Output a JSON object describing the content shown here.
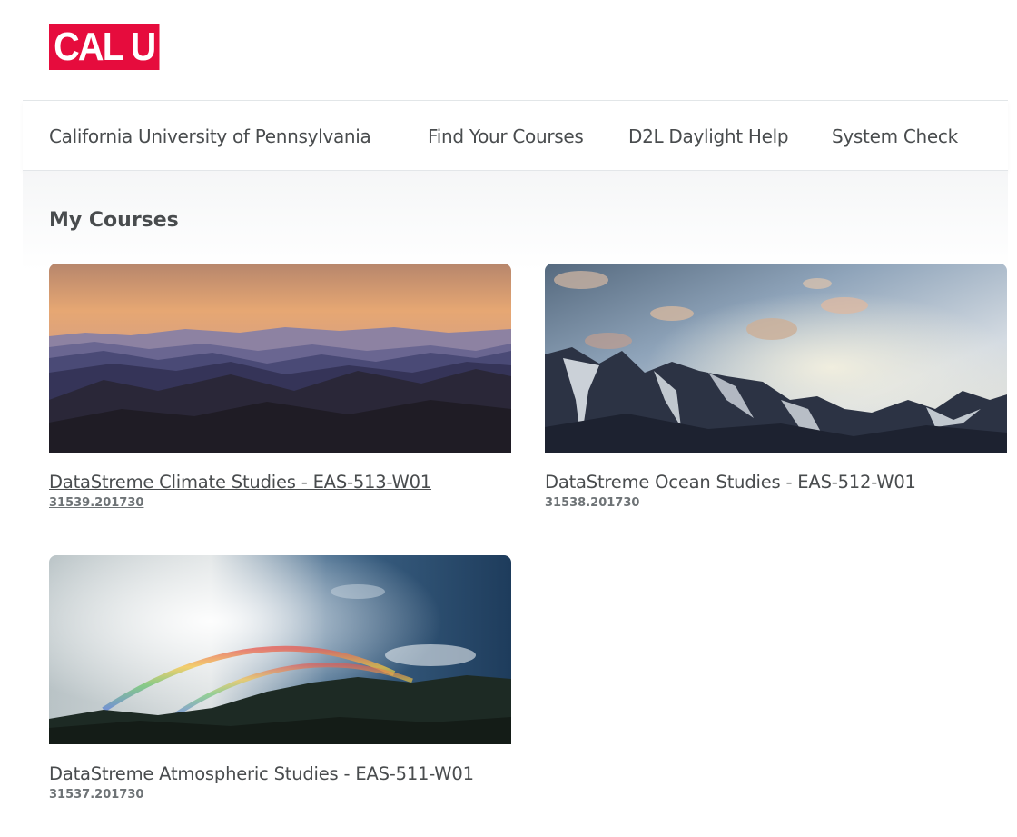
{
  "header": {
    "logo_text": "CAL U",
    "logo_color": "#e60c3d"
  },
  "nav": {
    "items": [
      {
        "label": "California University of Pennsylvania"
      },
      {
        "label": "Find Your Courses"
      },
      {
        "label": "D2L Daylight Help"
      },
      {
        "label": "System Check"
      }
    ]
  },
  "main": {
    "section_title": "My Courses",
    "courses": [
      {
        "title": "DataStreme Climate Studies - EAS-513-W01",
        "code": "31539.201730",
        "image": "sunset-mountain-layers"
      },
      {
        "title": "DataStreme Ocean Studies - EAS-512-W01",
        "code": "31538.201730",
        "image": "snowy-mountains-cloudy-sky"
      },
      {
        "title": "DataStreme Atmospheric Studies - EAS-511-W01",
        "code": "31537.201730",
        "image": "double-rainbow-storm"
      }
    ]
  }
}
